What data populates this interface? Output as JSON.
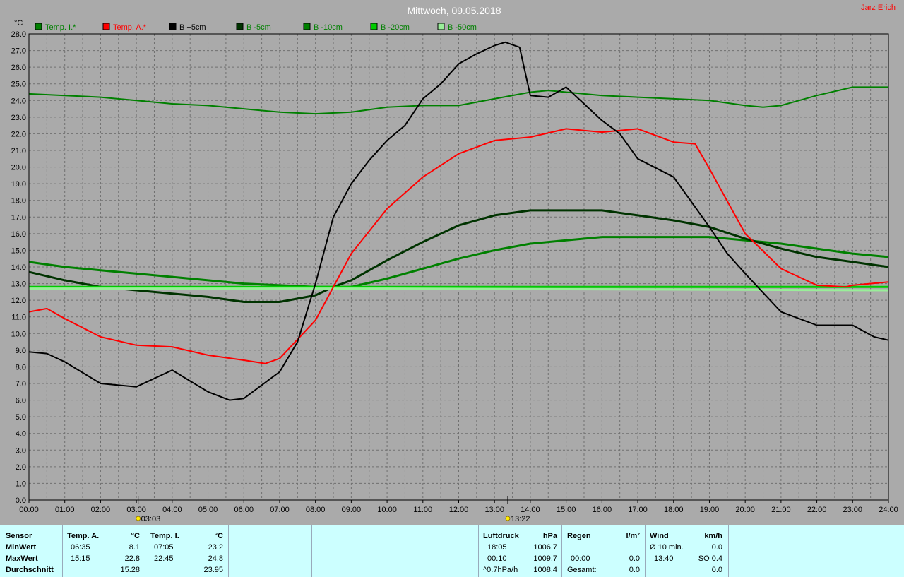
{
  "title": "Mittwoch, 09.05.2018",
  "author": "Jarz Erich",
  "chart_data": {
    "type": "line",
    "title": "Mittwoch, 09.05.2018",
    "ylabel": "°C",
    "xlabel": "",
    "ylim": [
      0,
      28
    ],
    "xlim": [
      0,
      24
    ],
    "grid": true,
    "legend_position": "top",
    "x_ticks": [
      "00:00",
      "01:00",
      "02:00",
      "03:00",
      "04:00",
      "05:00",
      "06:00",
      "07:00",
      "08:00",
      "09:00",
      "10:00",
      "11:00",
      "12:00",
      "13:00",
      "14:00",
      "15:00",
      "16:00",
      "17:00",
      "18:00",
      "19:00",
      "20:00",
      "21:00",
      "22:00",
      "23:00",
      "24:00"
    ],
    "y_ticks": [
      "0.0",
      "1.0",
      "2.0",
      "3.0",
      "4.0",
      "5.0",
      "6.0",
      "7.0",
      "8.0",
      "9.0",
      "10.0",
      "11.0",
      "12.0",
      "13.0",
      "14.0",
      "15.0",
      "16.0",
      "17.0",
      "18.0",
      "19.0",
      "20.0",
      "21.0",
      "22.0",
      "23.0",
      "24.0",
      "25.0",
      "26.0",
      "27.0",
      "28.0"
    ],
    "markers": [
      {
        "label": "03:03",
        "x": 3.05,
        "icon": "sunrise-icon"
      },
      {
        "label": "13:22",
        "x": 13.37,
        "icon": "noon-sun-icon"
      }
    ],
    "series": [
      {
        "name": "Temp. I.*",
        "color": "#008000",
        "width": 2,
        "x": [
          0,
          1,
          2,
          3,
          4,
          5,
          6,
          7,
          8,
          9,
          10,
          11,
          12,
          13,
          14,
          14.5,
          15,
          16,
          17,
          18,
          19,
          20,
          20.5,
          21,
          22,
          23,
          24
        ],
        "y": [
          24.4,
          24.3,
          24.2,
          24.0,
          23.8,
          23.7,
          23.5,
          23.3,
          23.2,
          23.3,
          23.6,
          23.7,
          23.7,
          24.1,
          24.5,
          24.6,
          24.5,
          24.3,
          24.2,
          24.1,
          24.0,
          23.7,
          23.6,
          23.7,
          24.3,
          24.8,
          24.8
        ]
      },
      {
        "name": "Temp. A.*",
        "color": "#ff0000",
        "width": 2,
        "x": [
          0,
          0.5,
          1,
          2,
          3,
          4,
          5,
          6,
          6.6,
          7,
          8,
          9,
          10,
          11,
          12,
          13,
          14,
          15,
          16,
          17,
          18,
          18.6,
          19,
          20,
          21,
          22,
          22.8,
          23,
          24
        ],
        "y": [
          11.3,
          11.5,
          10.9,
          9.8,
          9.3,
          9.2,
          8.7,
          8.4,
          8.2,
          8.5,
          10.8,
          14.8,
          17.5,
          19.4,
          20.8,
          21.6,
          21.8,
          22.3,
          22.1,
          22.3,
          21.5,
          21.4,
          19.9,
          16.0,
          13.9,
          12.9,
          12.8,
          12.9,
          13.1
        ]
      },
      {
        "name": "B +5cm",
        "color": "#000000",
        "width": 2,
        "x": [
          0,
          0.5,
          1,
          2,
          3,
          4,
          5,
          5.6,
          6,
          7,
          7.5,
          8,
          8.5,
          9,
          9.5,
          10,
          10.5,
          11,
          11.5,
          12,
          12.5,
          13,
          13.3,
          13.7,
          14,
          14.5,
          15,
          15.5,
          16,
          16.5,
          17,
          18,
          19,
          19.5,
          20,
          21,
          22,
          23,
          23.6,
          24
        ],
        "y": [
          8.9,
          8.8,
          8.3,
          7.0,
          6.8,
          7.8,
          6.5,
          6.0,
          6.1,
          7.7,
          9.5,
          13.0,
          17.0,
          19.0,
          20.4,
          21.6,
          22.5,
          24.1,
          25.0,
          26.2,
          26.8,
          27.3,
          27.5,
          27.2,
          24.3,
          24.2,
          24.8,
          23.8,
          22.8,
          22.0,
          20.5,
          19.4,
          16.4,
          14.8,
          13.6,
          11.3,
          10.5,
          10.5,
          9.8,
          9.6
        ]
      },
      {
        "name": "B -5cm",
        "color": "#003300",
        "width": 3,
        "x": [
          0,
          1,
          2,
          3,
          4,
          5,
          6,
          7,
          8,
          8.5,
          9,
          10,
          11,
          12,
          13,
          14,
          15,
          16,
          17,
          18,
          19,
          20,
          21,
          22,
          23,
          24
        ],
        "y": [
          13.7,
          13.2,
          12.8,
          12.6,
          12.4,
          12.2,
          11.9,
          11.9,
          12.3,
          12.8,
          13.2,
          14.4,
          15.5,
          16.5,
          17.1,
          17.4,
          17.4,
          17.4,
          17.1,
          16.8,
          16.4,
          15.7,
          15.1,
          14.6,
          14.3,
          14.0
        ]
      },
      {
        "name": "B -10cm",
        "color": "#008000",
        "width": 3,
        "x": [
          0,
          1,
          2,
          3,
          4,
          5,
          6,
          7,
          8,
          9,
          10,
          11,
          12,
          13,
          14,
          15,
          16,
          17,
          18,
          19,
          20,
          21,
          22,
          23,
          24
        ],
        "y": [
          14.3,
          14.0,
          13.8,
          13.6,
          13.4,
          13.2,
          13.0,
          12.9,
          12.8,
          12.8,
          13.3,
          13.9,
          14.5,
          15.0,
          15.4,
          15.6,
          15.8,
          15.8,
          15.8,
          15.8,
          15.6,
          15.4,
          15.1,
          14.8,
          14.6
        ]
      },
      {
        "name": "B -20cm",
        "color": "#00cc00",
        "width": 3,
        "x": [
          0,
          24
        ],
        "y": [
          12.8,
          12.8
        ]
      },
      {
        "name": "B -50cm",
        "color": "#99ee99",
        "width": 3,
        "x": [
          0,
          10,
          24
        ],
        "y": [
          12.7,
          12.7,
          12.6
        ]
      }
    ]
  },
  "footer": {
    "sensor": {
      "header": "Sensor",
      "rows": [
        "MinWert",
        "MaxWert",
        "Durchschnitt"
      ]
    },
    "temp_a": {
      "header": "Temp. A.",
      "unit": "°C",
      "min_time": "06:35",
      "min_val": "8.1",
      "max_time": "15:15",
      "max_val": "22.8",
      "avg": "15.28"
    },
    "temp_i": {
      "header": "Temp. I.",
      "unit": "°C",
      "min_time": "07:05",
      "min_val": "23.2",
      "max_time": "22:45",
      "max_val": "24.8",
      "avg": "23.95"
    },
    "luftdruck": {
      "header": "Luftdruck",
      "unit": "hPa",
      "min_time": "18:05",
      "min_val": "1006.7",
      "max_time": "00:10",
      "max_val": "1009.7",
      "trend_label": "^0.7hPa/h",
      "trend_val": "1008.4"
    },
    "regen": {
      "header": "Regen",
      "unit": "l/m²",
      "r1": "0.0",
      "r2_time": "00:00",
      "r2_val": "0.0",
      "total_label": "Gesamt:",
      "total_val": "0.0"
    },
    "wind": {
      "header": "Wind",
      "unit": "km/h",
      "avg_label": "Ø 10 min.",
      "avg_val": "0.0",
      "max_time": "13:40",
      "max_val": "SO 0.4",
      "r3": "0.0"
    }
  }
}
